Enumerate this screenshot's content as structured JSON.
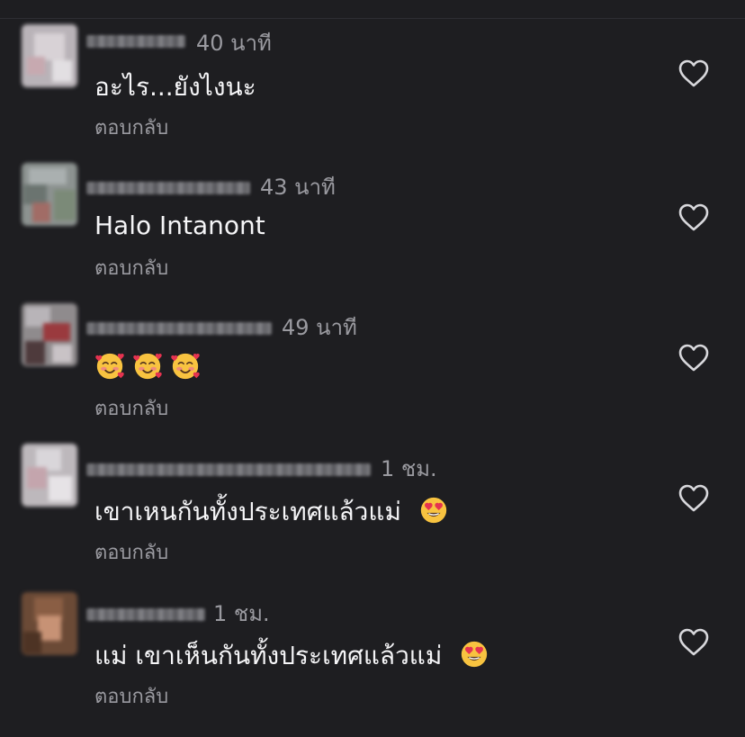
{
  "reply_label": "ตอบกลับ",
  "comments": [
    {
      "time": "40 นาที",
      "text": "อะไร...ยังไงนะ",
      "emojis": [],
      "liked": false
    },
    {
      "time": "43 นาที",
      "text": "Halo Intanont",
      "emojis": [],
      "liked": false
    },
    {
      "time": "49 นาที",
      "text": "",
      "emojis": [
        "smiling-face-with-hearts",
        "smiling-face-with-hearts",
        "smiling-face-with-hearts"
      ],
      "liked": false
    },
    {
      "time": "1 ชม.",
      "text": "เขาเหนกันทั้งประเทศแล้วแม่",
      "emojis": [
        "heart-eyes"
      ],
      "liked": false
    },
    {
      "time": "1 ชม.",
      "text": "แม่ เขาเห็นกันทั้งประเทศแล้วแม่",
      "emojis": [
        "heart-eyes"
      ],
      "liked": false
    }
  ],
  "colors": {
    "background": "#1e1e21",
    "primary_text": "#f5f5f7",
    "secondary_text": "#9a9aa0"
  }
}
